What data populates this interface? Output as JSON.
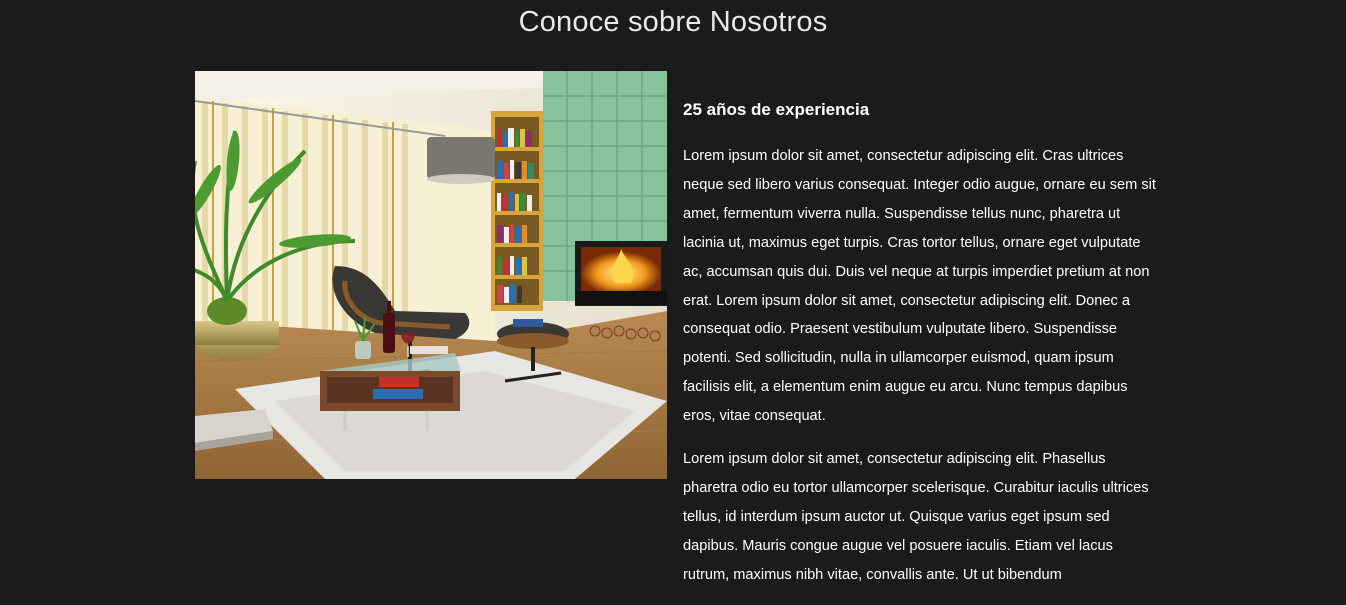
{
  "about": {
    "title": "Conoce sobre Nosotros",
    "subtitle": "25 años de experiencia",
    "paragraph_1": "Lorem ipsum dolor sit amet, consectetur adipiscing elit. Cras ultrices neque sed libero varius consequat. Integer odio augue, ornare eu sem sit amet, fermentum viverra nulla. Suspendisse tellus nunc, pharetra ut lacinia ut, maximus eget turpis. Cras tortor tellus, ornare eget vulputate ac, accumsan quis dui. Duis vel neque at turpis imperdiet pretium at non erat. Lorem ipsum dolor sit amet, consectetur adipiscing elit. Donec a consequat odio. Praesent vestibulum vulputate libero. Suspendisse potenti. Sed sollicitudin, nulla in ullamcorper euismod, quam ipsum facilisis elit, a elementum enim augue eu arcu. Nunc tempus dapibus eros, vitae consequat.",
    "paragraph_2": "Lorem ipsum dolor sit amet, consectetur adipiscing elit. Phasellus pharetra odio eu tortor ullamcorper scelerisque. Curabitur iaculis ultrices tellus, id interdum ipsum auctor ut. Quisque varius eget ipsum sed dapibus. Mauris congue augue vel posuere iaculis. Etiam vel lacus rutrum, maximus nibh vitae, convallis ante. Ut ut bibendum"
  },
  "colors": {
    "background": "#1b1b1c",
    "text": "#ffffff",
    "accent_wall": "#86c39c"
  }
}
